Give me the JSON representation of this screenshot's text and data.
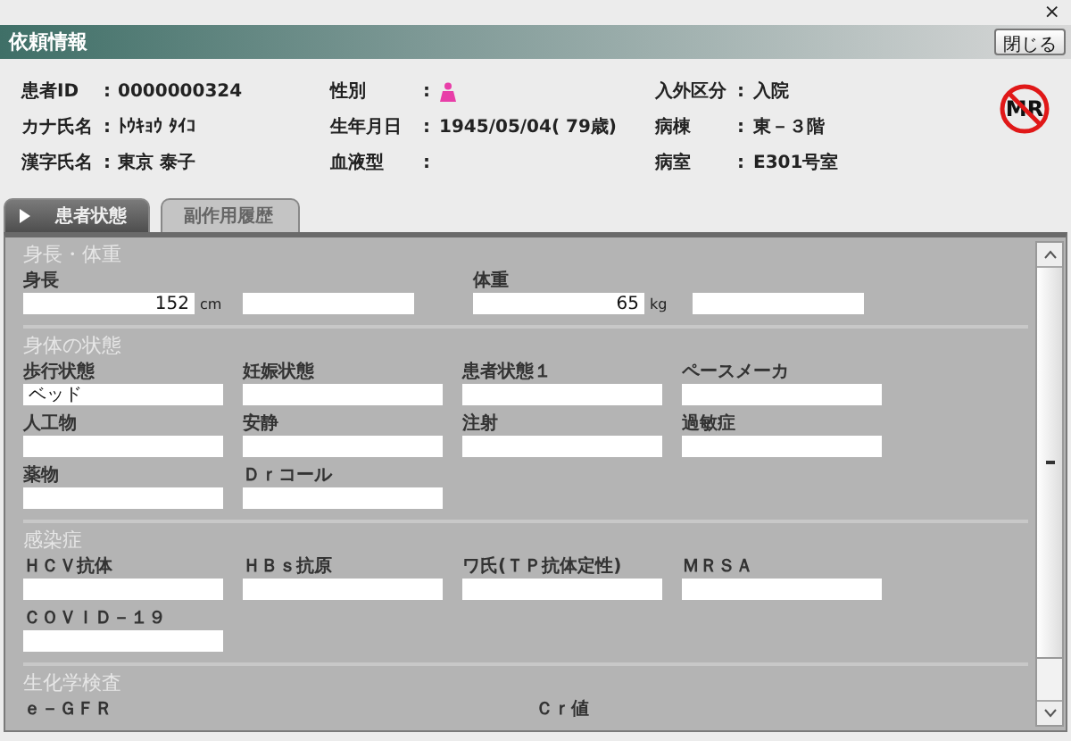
{
  "window": {
    "close": "×",
    "title": "依頼情報",
    "close_button": "閉じる"
  },
  "patient": {
    "columns": [
      [
        {
          "label": "患者ID",
          "value": "0000000324"
        },
        {
          "label": "カナ氏名",
          "value": "ﾄｳｷｮｳ ﾀｲｺ"
        },
        {
          "label": "漢字氏名",
          "value": "東京 泰子"
        }
      ],
      [
        {
          "label": "性別",
          "kind": "icon"
        },
        {
          "label": "生年月日",
          "value": "1945/05/04( 79歳)"
        },
        {
          "label": "血液型"
        }
      ],
      [
        {
          "label": "入外区分",
          "value": "入院"
        },
        {
          "label": "病棟",
          "value": "東－３階"
        },
        {
          "label": "病室",
          "value": "E301号室"
        }
      ]
    ],
    "colon": ":",
    "badge": "MR"
  },
  "tabs": [
    {
      "label": "患者状態",
      "selected": true
    },
    {
      "label": "副作用履歴",
      "selected": false
    }
  ],
  "sections": [
    {
      "title": "身長・体重",
      "kind": "measure",
      "fields": [
        {
          "label": "身長",
          "value": "152",
          "unit": "cm"
        },
        {
          "label": "体重",
          "value": "65",
          "unit": "kg"
        }
      ]
    },
    {
      "title": "身体の状態",
      "kind": "grid",
      "fields": [
        {
          "label": "歩行状態",
          "value": "ベッド"
        },
        {
          "label": "妊娠状態"
        },
        {
          "label": "患者状態１"
        },
        {
          "label": "ペースメーカ"
        },
        {
          "label": "人工物"
        },
        {
          "label": "安静"
        },
        {
          "label": "注射"
        },
        {
          "label": "過敏症"
        },
        {
          "label": "薬物"
        },
        {
          "label": "Ｄｒコール"
        }
      ]
    },
    {
      "title": "感染症",
      "kind": "grid",
      "fields": [
        {
          "label": "ＨＣＶ抗体"
        },
        {
          "label": "ＨＢｓ抗原"
        },
        {
          "label": "ワ氏(ＴＰ抗体定性)"
        },
        {
          "label": "ＭＲＳＡ"
        },
        {
          "label": "ＣＯＶＩＤ－１９"
        }
      ]
    },
    {
      "title": "生化学検査",
      "kind": "labels",
      "fields": [
        {
          "label": "ｅ－ＧＦＲ"
        },
        {
          "label": "Ｃｒ値"
        }
      ]
    }
  ]
}
